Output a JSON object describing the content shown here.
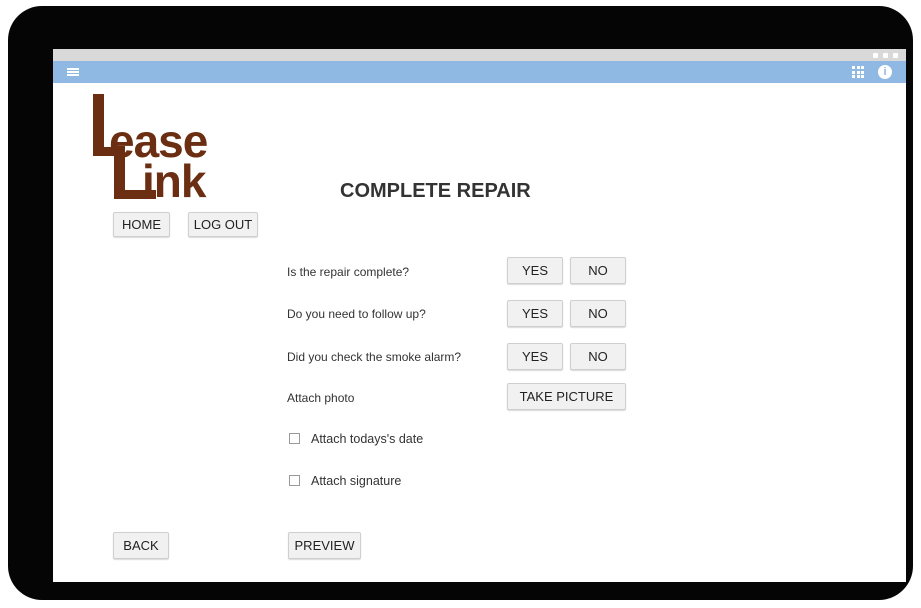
{
  "logo": {
    "line1": "ease",
    "line2": "ink"
  },
  "page_title": "COMPLETE REPAIR",
  "nav": {
    "home": "HOME",
    "logout": "LOG OUT",
    "back": "BACK",
    "preview": "PREVIEW"
  },
  "questions": [
    {
      "label": "Is the repair complete?",
      "yes": "YES",
      "no": "NO"
    },
    {
      "label": "Do you need to follow up?",
      "yes": "YES",
      "no": "NO"
    },
    {
      "label": "Did you check the smoke alarm?",
      "yes": "YES",
      "no": "NO"
    }
  ],
  "attach_photo": {
    "label": "Attach photo",
    "button": "TAKE PICTURE"
  },
  "checkboxes": [
    {
      "label": "Attach todays's date",
      "checked": false
    },
    {
      "label": "Attach signature",
      "checked": false
    }
  ],
  "colors": {
    "app_bar": "#8fb8e3",
    "logo": "#6b2e12",
    "device_frame": "#050505"
  },
  "icons": {
    "menu": "menu-icon",
    "apps": "grid-icon",
    "info": "info-icon"
  }
}
